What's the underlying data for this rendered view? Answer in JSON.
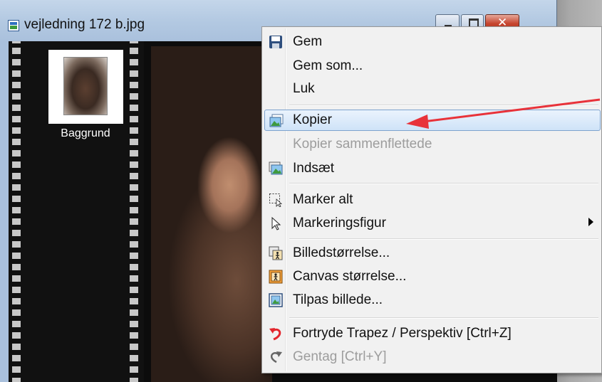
{
  "window": {
    "title": "vejledning 172 b.jpg"
  },
  "layers": {
    "items": [
      {
        "label": "Baggrund"
      }
    ]
  },
  "context_menu": {
    "items": [
      {
        "label": "Gem",
        "icon": "save-icon",
        "enabled": true
      },
      {
        "label": "Gem som...",
        "icon": "",
        "enabled": true
      },
      {
        "label": "Luk",
        "icon": "",
        "enabled": true
      },
      {
        "label": "Kopier",
        "icon": "copy-image-icon",
        "enabled": true,
        "highlighted": true
      },
      {
        "label": "Kopier sammenflettede",
        "icon": "",
        "enabled": false
      },
      {
        "label": "Indsæt",
        "icon": "paste-icon",
        "enabled": true
      },
      {
        "label": "Marker alt",
        "icon": "select-all-icon",
        "enabled": true
      },
      {
        "label": "Markeringsfigur",
        "icon": "cursor-arrow-icon",
        "enabled": true,
        "submenu": true
      },
      {
        "label": "Billedstørrelse...",
        "icon": "image-size-icon",
        "enabled": true
      },
      {
        "label": "Canvas størrelse...",
        "icon": "canvas-size-icon",
        "enabled": true
      },
      {
        "label": "Tilpas billede...",
        "icon": "fit-image-icon",
        "enabled": true
      },
      {
        "label": "Fortryde Trapez / Perspektiv [Ctrl+Z]",
        "icon": "undo-icon",
        "enabled": true
      },
      {
        "label": "Gentag [Ctrl+Y]",
        "icon": "redo-icon",
        "enabled": false
      }
    ]
  },
  "colors": {
    "highlight_border": "#7da2ce",
    "annotation_arrow": "#e8323a",
    "undo_icon": "#e3262d"
  }
}
